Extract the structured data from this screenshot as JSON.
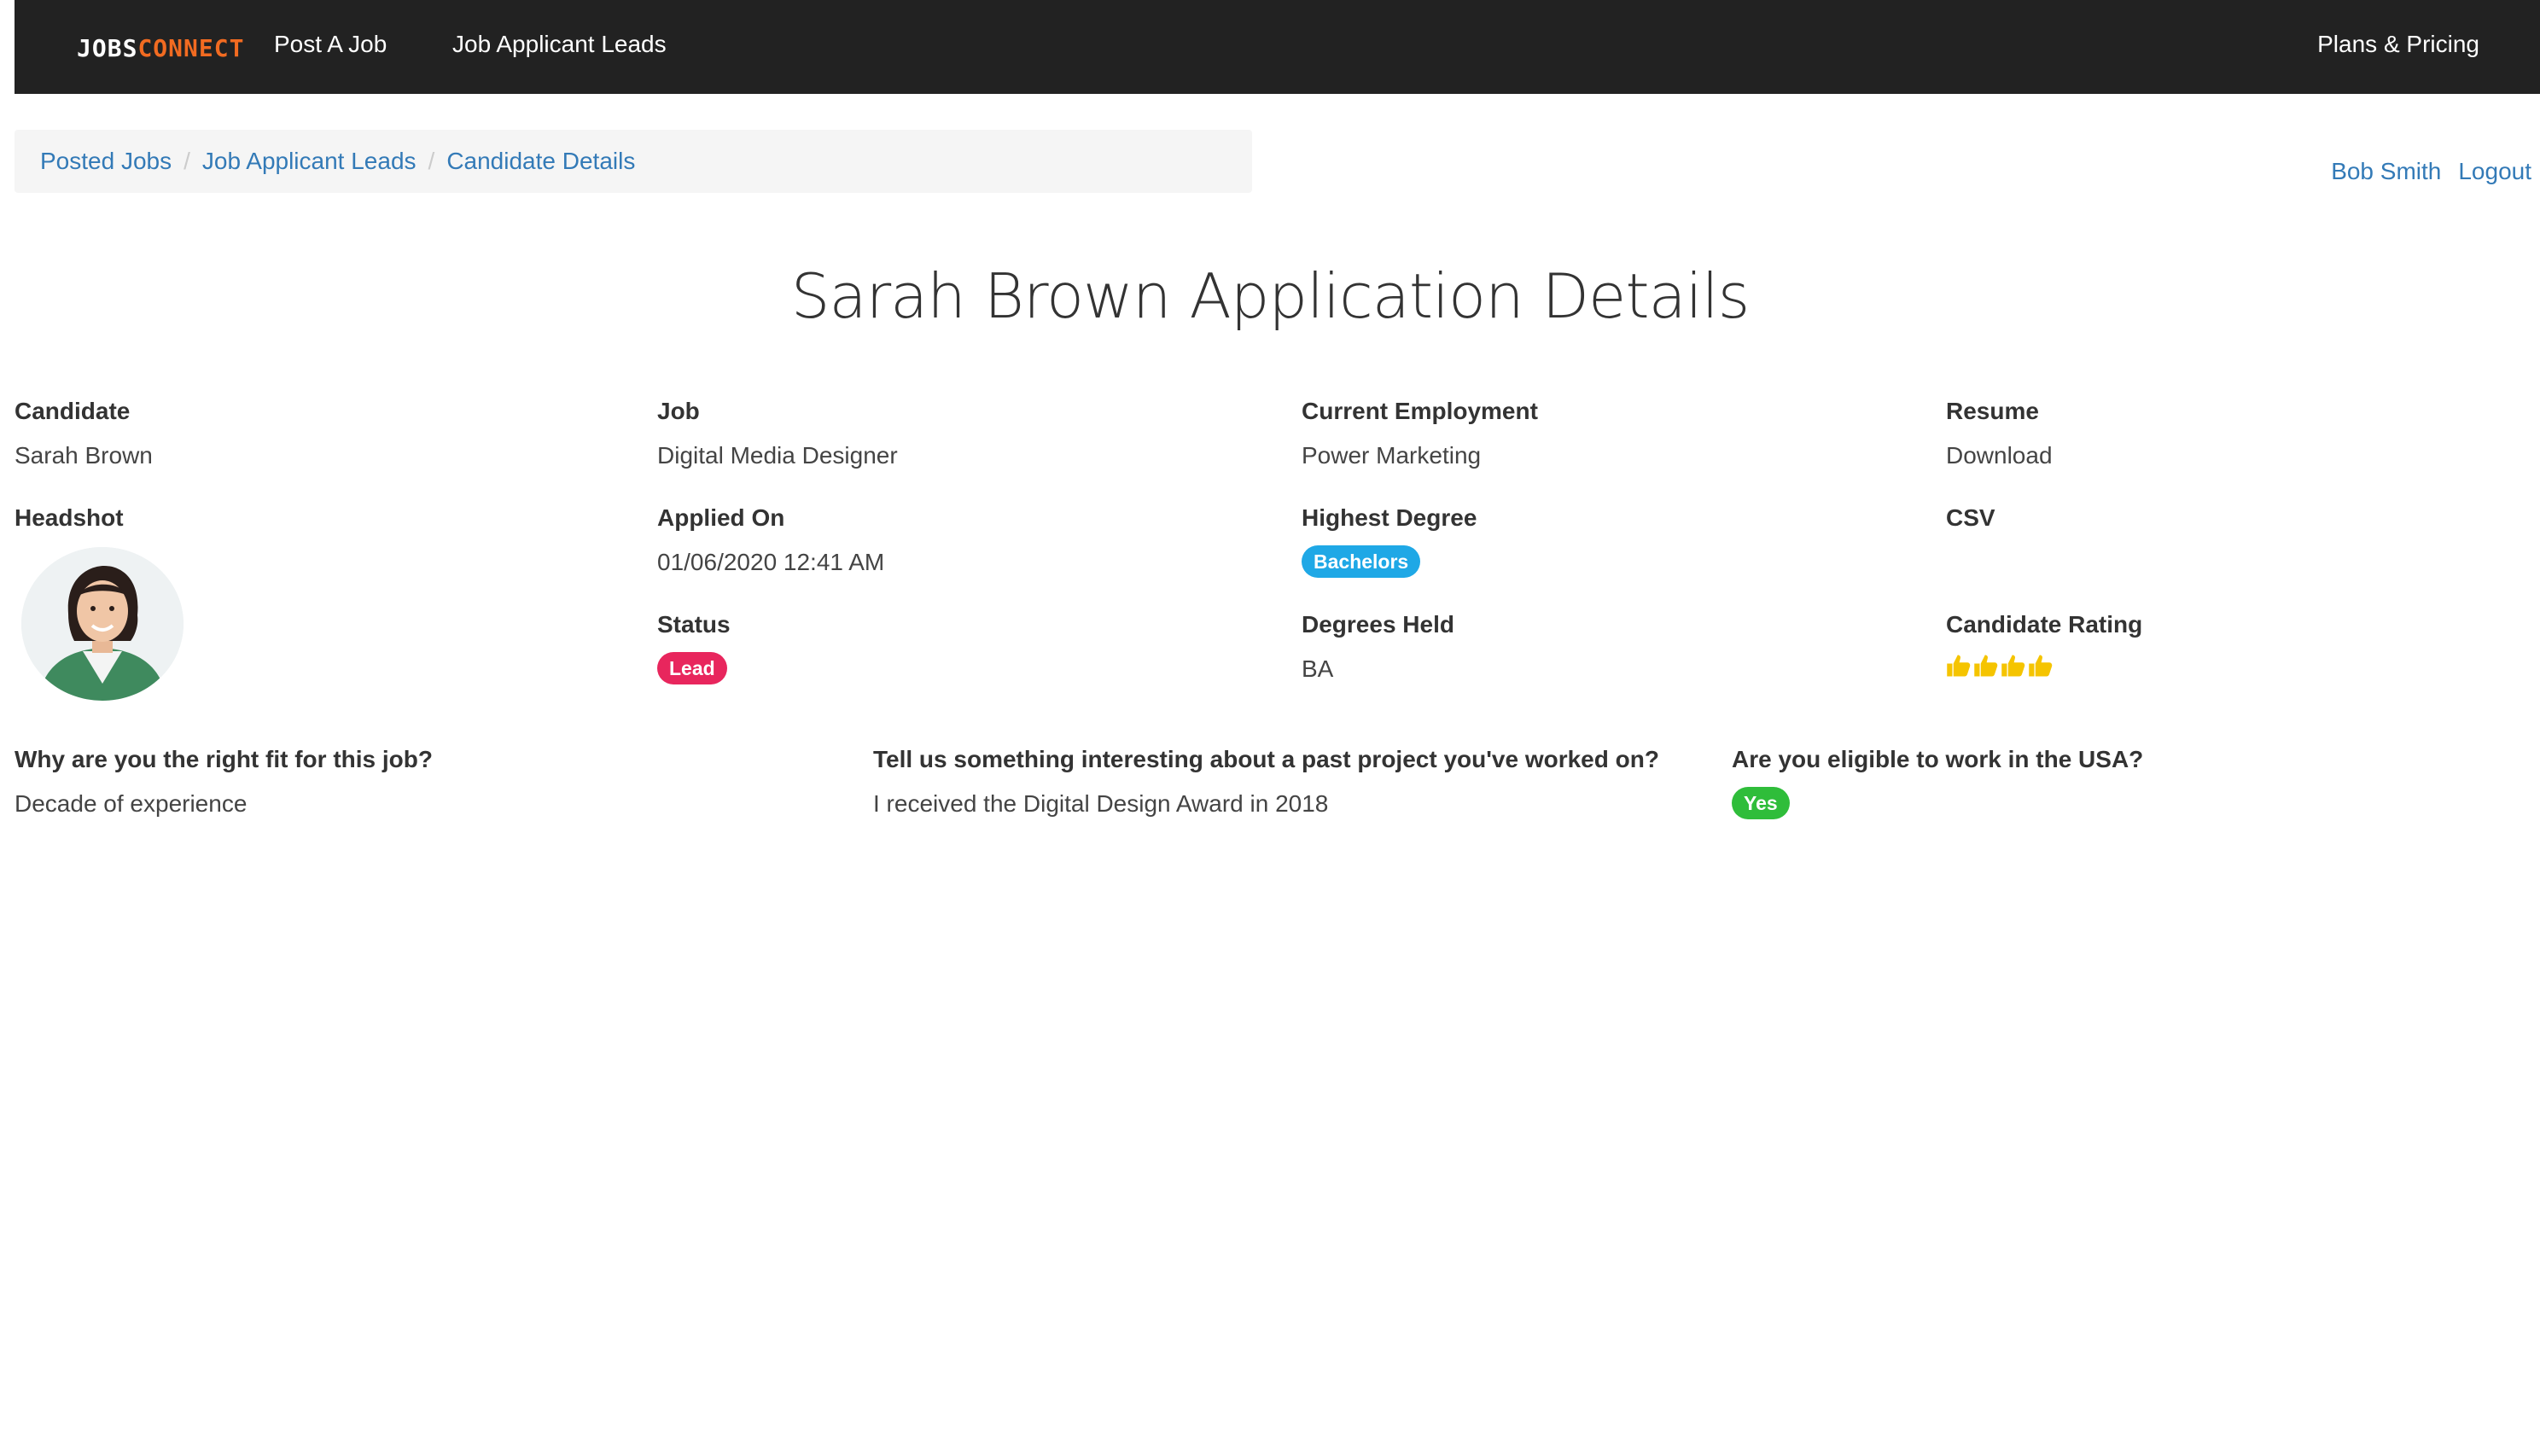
{
  "navbar": {
    "brand_part1": "JOBS",
    "brand_part2": "CONNECT",
    "post_job": "Post A Job",
    "applicant_leads": "Job Applicant Leads",
    "plans_pricing": "Plans & Pricing"
  },
  "breadcrumb": {
    "items": [
      "Posted Jobs",
      "Job Applicant Leads",
      "Candidate Details"
    ],
    "separator": "/"
  },
  "user": {
    "name": "Bob Smith",
    "logout": "Logout"
  },
  "page": {
    "title": "Sarah Brown Application Details"
  },
  "details": {
    "candidate": {
      "label": "Candidate",
      "value": "Sarah Brown"
    },
    "job": {
      "label": "Job",
      "value": "Digital Media Designer"
    },
    "current_employment": {
      "label": "Current Employment",
      "value": "Power Marketing"
    },
    "resume": {
      "label": "Resume",
      "value": "Download"
    },
    "headshot": {
      "label": "Headshot"
    },
    "applied_on": {
      "label": "Applied On",
      "value": "01/06/2020 12:41 AM"
    },
    "highest_degree": {
      "label": "Highest Degree",
      "value": "Bachelors"
    },
    "csv": {
      "label": "CSV"
    },
    "status": {
      "label": "Status",
      "value": "Lead"
    },
    "degrees_held": {
      "label": "Degrees Held",
      "value": "BA"
    },
    "candidate_rating": {
      "label": "Candidate Rating",
      "value": 4,
      "max": 4,
      "icon": "thumbs-up-icon"
    }
  },
  "questions": [
    {
      "label": "Why are you the right fit for this job?",
      "answer": "Decade of experience"
    },
    {
      "label": "Tell us something interesting about a past project you've worked on?",
      "answer": "I received the Digital Design Award in 2018"
    },
    {
      "label": "Are you eligible to work in the USA?",
      "answer": "Yes"
    }
  ],
  "colors": {
    "navbar_bg": "#222222",
    "brand_accent": "#f26b21",
    "link": "#337ab7",
    "badge_degree": "#1fa8e6",
    "badge_status": "#e8265d",
    "badge_yes": "#2fbd3a",
    "rating": "#f5c400"
  }
}
